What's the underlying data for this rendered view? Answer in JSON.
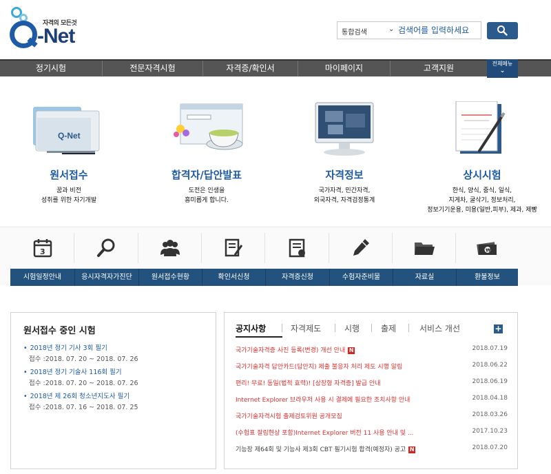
{
  "header": {
    "logo_slogan": "자격의 모든것",
    "logo_text": "-Net",
    "search_scope": "통합검색",
    "search_placeholder": "검색어를 입력하세요"
  },
  "gnb": {
    "items": [
      "정기시험",
      "전문자격시험",
      "자격증/확인서",
      "마이페이지",
      "고객지원"
    ],
    "all_menu": "전체메뉴"
  },
  "features": [
    {
      "title": "원서접수",
      "desc": "꿈과 비전\n성취를 위한 자기개발"
    },
    {
      "title": "합격자/답안발표",
      "desc": "도전은 인생을\n흥미롭게 합니다."
    },
    {
      "title": "자격정보",
      "desc": "국가자격, 민간자격,\n외국자격, 자격검정통계"
    },
    {
      "title": "상시시험",
      "desc": "한식, 양식, 중식, 일식,\n지게차, 굴삭기, 정보처리,\n정보기기운용, 미용(일반,피부), 제과, 제빵"
    }
  ],
  "quick": [
    {
      "label": "시험일정안내",
      "icon": "calendar-icon"
    },
    {
      "label": "응시자격자가진단",
      "icon": "magnifier-icon"
    },
    {
      "label": "원서접수현황",
      "icon": "people-icon"
    },
    {
      "label": "확인서신청",
      "icon": "document-edit-icon"
    },
    {
      "label": "자격증신청",
      "icon": "certificate-icon"
    },
    {
      "label": "수험자준비물",
      "icon": "pencil-icon"
    },
    {
      "label": "자료실",
      "icon": "folder-icon"
    },
    {
      "label": "환불정보",
      "icon": "money-icon"
    }
  ],
  "exam_box": {
    "title": "원서접수 중인 시험",
    "exams": [
      {
        "name": "2018년 정기 기사 3회 필기",
        "period": "접수 :2018. 07. 20 ~ 2018. 07. 26"
      },
      {
        "name": "2018년 정기 기술사 116회 필기",
        "period": "접수 :2018. 07. 20 ~ 2018. 07. 26"
      },
      {
        "name": "2018년 제 26회 청소년지도사 필기",
        "period": "접수 :2018. 07. 16 ~ 2018. 07. 25"
      }
    ]
  },
  "notice_box": {
    "tabs": [
      "공지사항",
      "자격제도",
      "시행",
      "출제",
      "서비스 개선"
    ],
    "new_badge": "N",
    "plus": "+",
    "rows": [
      {
        "title": "국가기술자격증 사진 등록(변경) 개선 안내",
        "date": "2018.07.19",
        "new": true,
        "red": true
      },
      {
        "title": "국가기술자격 답안카드(답안지) 제출 불응자 처리 제도 시행 알림",
        "date": "2018.06.22",
        "new": false,
        "red": true
      },
      {
        "title": "편리! 무료! 동일(법적 효력)! [상장형 자격증] 발급 안내",
        "date": "2018.06.19",
        "new": false,
        "red": true
      },
      {
        "title": "Internet Explorer 브라우저 사용 시 결제에 필요한 조치사항 안내",
        "date": "2018.04.18",
        "new": false,
        "red": true
      },
      {
        "title": "국가기술자격시험 출제검토위원 공개모집",
        "date": "2018.03.26",
        "new": false,
        "red": true
      },
      {
        "title": "(수험표 잘림현상 포함)Internet Explorer 버전 11 사용 안내 및 ...",
        "date": "2017.10.23",
        "new": false,
        "red": true
      },
      {
        "title": "기능장 제64회 및 기능사 제3회 CBT 필기시험 합격(예정자) 공고",
        "date": "2018.07.20",
        "new": true,
        "red": false
      }
    ]
  }
}
